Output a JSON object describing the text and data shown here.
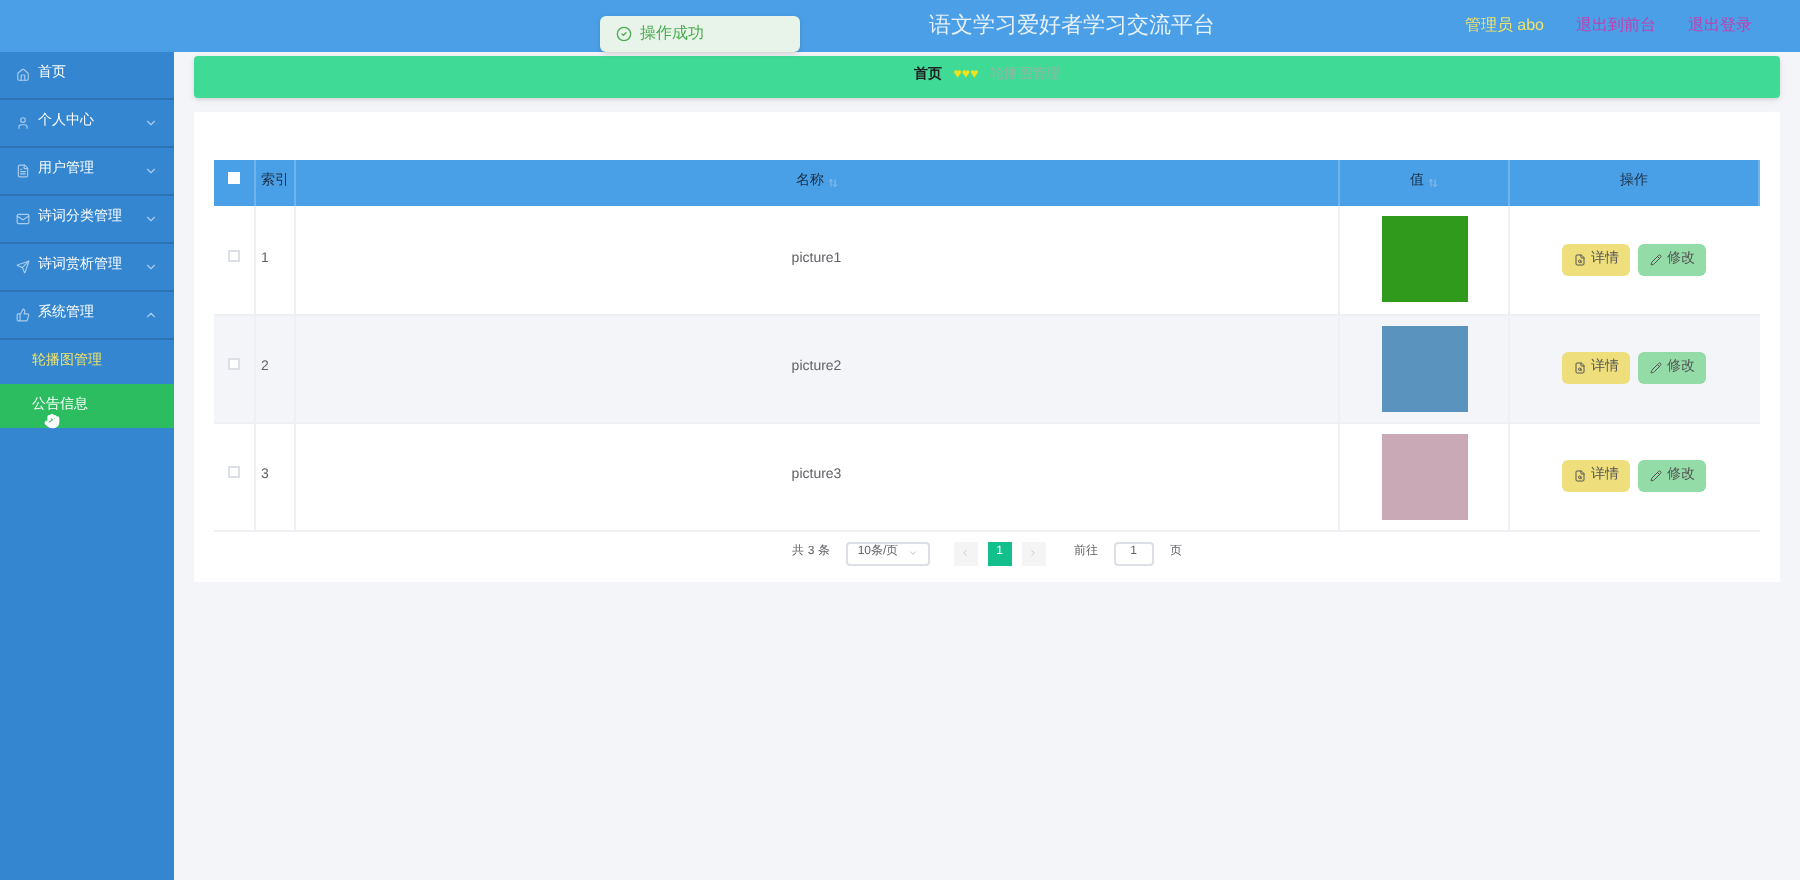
{
  "header": {
    "title": "语文学习爱好者学习交流平台",
    "user": "管理员 abo",
    "links": [
      "退出到前台",
      "退出登录"
    ]
  },
  "toast": {
    "text": "操作成功"
  },
  "sidebar": {
    "items": [
      {
        "label": "首页",
        "kind": "link",
        "selected": false,
        "hovered": false
      },
      {
        "label": "个人中心",
        "kind": "group",
        "expanded": false,
        "selected": false,
        "hovered": false
      },
      {
        "label": "用户管理",
        "kind": "group",
        "expanded": false,
        "selected": false,
        "hovered": false
      },
      {
        "label": "诗词分类管理",
        "kind": "group",
        "expanded": false,
        "selected": false,
        "hovered": false
      },
      {
        "label": "诗词赏析管理",
        "kind": "group",
        "expanded": false,
        "selected": false,
        "hovered": false
      },
      {
        "label": "系统管理",
        "kind": "group",
        "expanded": true,
        "selected": false,
        "hovered": false,
        "children": [
          {
            "label": "轮播图管理",
            "selected": true,
            "hovered": false
          },
          {
            "label": "公告信息",
            "selected": false,
            "hovered": true
          }
        ]
      }
    ]
  },
  "breadcrumb": {
    "home": "首页",
    "separator": "♥♥♥",
    "current": "轮播图管理"
  },
  "table": {
    "columns": [
      {
        "label": "索引",
        "sortable": false
      },
      {
        "label": "名称",
        "sortable": true
      },
      {
        "label": "值",
        "sortable": true
      },
      {
        "label": "操作",
        "sortable": false
      }
    ],
    "all_checked": false,
    "rows": [
      {
        "index": "1",
        "name": "picture1",
        "checked": false,
        "color": "#2f9a1c",
        "actions": [
          "详情",
          "修改"
        ]
      },
      {
        "index": "2",
        "name": "picture2",
        "checked": false,
        "color": "#5b93bf",
        "actions": [
          "详情",
          "修改"
        ]
      },
      {
        "index": "3",
        "name": "picture3",
        "checked": false,
        "color": "#c9a9b6",
        "actions": [
          "详情",
          "修改"
        ]
      }
    ]
  },
  "pagination": {
    "total": "共 3 条",
    "page_size": "10条/页",
    "pages": [
      {
        "label": "1",
        "selected": true
      }
    ],
    "goto_label": "前往",
    "goto_value": "1",
    "goto_suffix": "页"
  }
}
